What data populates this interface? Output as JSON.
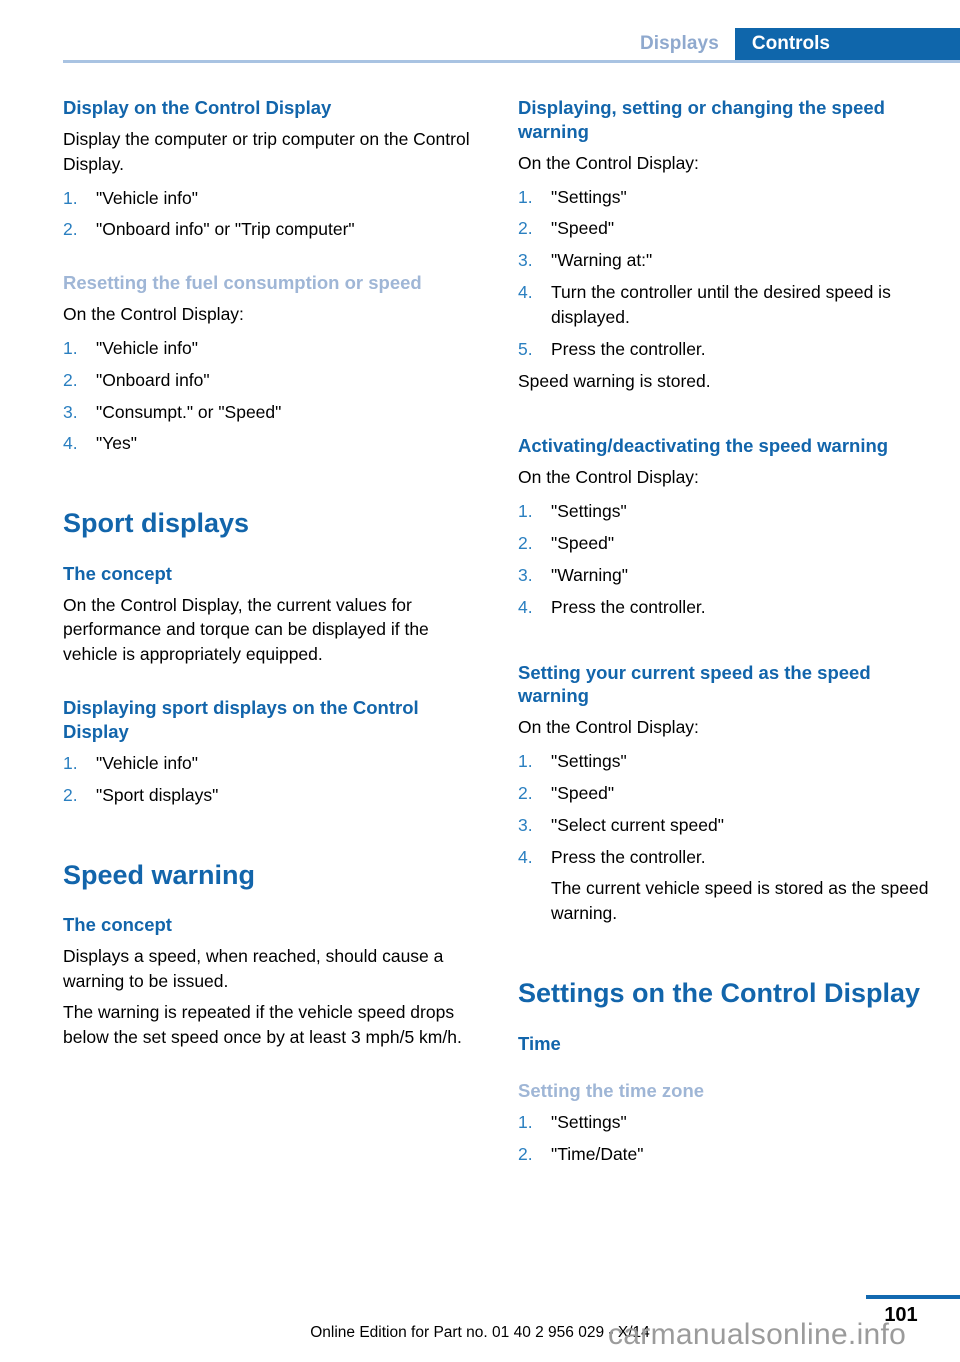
{
  "header": {
    "chapter": "Displays",
    "section": "Controls"
  },
  "left_column": {
    "block1": {
      "heading": "Display on the Control Display",
      "intro": "Display the computer or trip computer on the Control Display.",
      "steps": [
        "\"Vehicle info\"",
        "\"Onboard info\" or \"Trip computer\""
      ]
    },
    "block2": {
      "heading": "Resetting the fuel consumption or speed",
      "intro": "On the Control Display:",
      "steps": [
        "\"Vehicle info\"",
        "\"Onboard info\"",
        "\"Consumpt.\" or \"Speed\"",
        "\"Yes\""
      ]
    },
    "block3": {
      "title": "Sport displays",
      "sub_heading": "The concept",
      "body": "On the Control Display, the current values for performance and torque can be displayed if the vehicle is appropriately equipped."
    },
    "block4": {
      "heading": "Displaying sport displays on the Control Display",
      "steps": [
        "\"Vehicle info\"",
        "\"Sport displays\""
      ]
    },
    "block5": {
      "title": "Speed warning",
      "sub_heading": "The concept",
      "para1": "Displays a speed, when reached, should cause a warning to be issued.",
      "para2": "The warning is repeated if the vehicle speed drops below the set speed once by at least 3 mph/5 km/h."
    }
  },
  "right_column": {
    "block1": {
      "heading": "Displaying, setting or changing the speed warning",
      "intro": "On the Control Display:",
      "steps": [
        "\"Settings\"",
        "\"Speed\"",
        "\"Warning at:\"",
        "Turn the controller until the desired speed is displayed.",
        "Press the controller."
      ],
      "outro": "Speed warning is stored."
    },
    "block2": {
      "heading": "Activating/deactivating the speed warning",
      "intro": "On the Control Display:",
      "steps": [
        "\"Settings\"",
        "\"Speed\"",
        "\"Warning\"",
        "Press the controller."
      ]
    },
    "block3": {
      "heading": "Setting your current speed as the speed warning",
      "intro": "On the Control Display:",
      "steps": [
        "\"Settings\"",
        "\"Speed\"",
        "\"Select current speed\"",
        "Press the controller."
      ],
      "step4_note": "The current vehicle speed is stored as the speed warning."
    },
    "block4": {
      "title": "Settings on the Control Display",
      "sub_heading": "Time",
      "minor_heading": "Setting the time zone",
      "steps": [
        "\"Settings\"",
        "\"Time/Date\""
      ]
    }
  },
  "footer": {
    "page_number": "101",
    "edition_note": "Online Edition for Part no. 01 40 2 956 029 - X/14",
    "watermark": "carmanualsonline.info"
  },
  "colors": {
    "heading_blue": "#1265ab",
    "muted_blue": "#9fb6d6",
    "tab_blue": "#0f66ab",
    "list_number_blue": "#2a7fc0",
    "rule_blue": "#a9c3e2"
  }
}
